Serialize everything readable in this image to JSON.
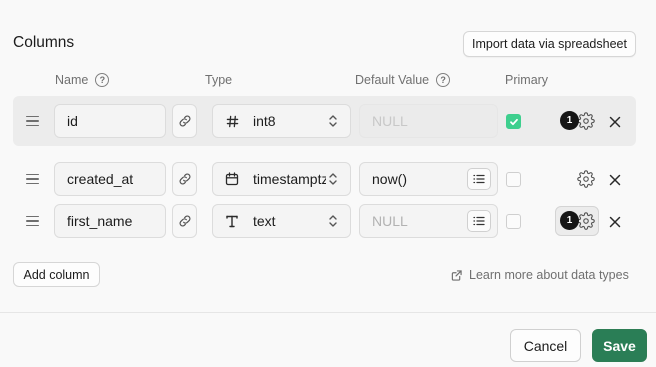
{
  "header": {
    "title": "Columns",
    "import_label": "Import data via spreadsheet"
  },
  "columns_header": {
    "name": "Name",
    "type": "Type",
    "default_value": "Default Value",
    "primary": "Primary",
    "help_glyph": "?"
  },
  "rows": [
    {
      "name": "id",
      "type_icon": "hash-icon",
      "type": "int8",
      "default": "NULL",
      "default_is_placeholder": true,
      "default_disabled": true,
      "primary": true,
      "badge": "1",
      "highlighted": true
    },
    {
      "name": "created_at",
      "type_icon": "calendar-icon",
      "type": "timestamptz",
      "default": "now()",
      "default_is_placeholder": false,
      "default_disabled": false,
      "primary": false,
      "badge": "",
      "highlighted": false
    },
    {
      "name": "first_name",
      "type_icon": "text-icon",
      "type": "text",
      "default": "NULL",
      "default_is_placeholder": true,
      "default_disabled": false,
      "primary": false,
      "badge": "1",
      "highlighted": false
    }
  ],
  "footer": {
    "add_column_label": "Add column",
    "learn_more_label": "Learn more about data types",
    "cancel_label": "Cancel",
    "save_label": "Save"
  },
  "colors": {
    "accent_green": "#3ecf8e",
    "save_green": "#2a7e56",
    "badge_black": "#161616"
  }
}
